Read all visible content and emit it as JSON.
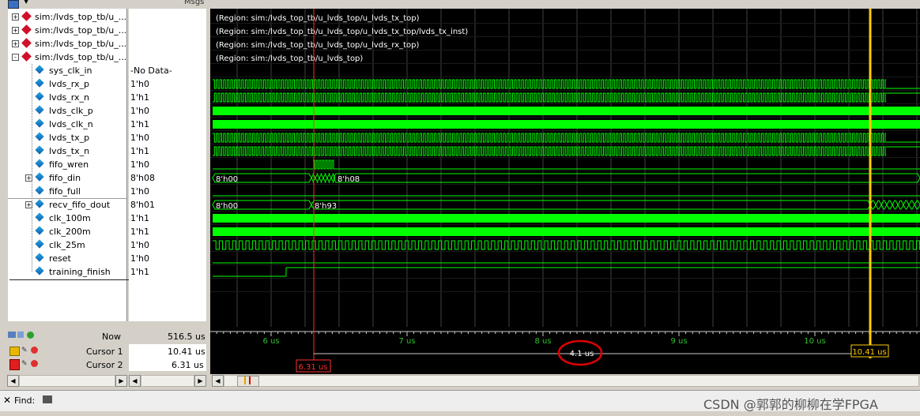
{
  "header": {
    "msgs_label": "Msgs"
  },
  "signals": [
    {
      "name": "sim:/lvds_top_tb/u_...",
      "value": "",
      "kind": "region",
      "expander": "+",
      "desc": "(Region: sim:/lvds_top_tb/u_lvds_top/u_lvds_tx_top)"
    },
    {
      "name": "sim:/lvds_top_tb/u_...",
      "value": "",
      "kind": "region",
      "expander": "+",
      "desc": "(Region: sim:/lvds_top_tb/u_lvds_top/u_lvds_tx_top/lvds_tx_inst)"
    },
    {
      "name": "sim:/lvds_top_tb/u_...",
      "value": "",
      "kind": "region",
      "expander": "+",
      "desc": "(Region: sim:/lvds_top_tb/u_lvds_top/u_lvds_rx_top)"
    },
    {
      "name": "sim:/lvds_top_tb/u_...",
      "value": "",
      "kind": "region",
      "expander": "-",
      "desc": "(Region: sim:/lvds_top_tb/u_lvds_top)"
    },
    {
      "name": "sys_clk_in",
      "value": "-No Data-",
      "kind": "signal"
    },
    {
      "name": "lvds_rx_p",
      "value": "1'h0",
      "kind": "signal"
    },
    {
      "name": "lvds_rx_n",
      "value": "1'h1",
      "kind": "signal"
    },
    {
      "name": "lvds_clk_p",
      "value": "1'h0",
      "kind": "signal"
    },
    {
      "name": "lvds_clk_n",
      "value": "1'h1",
      "kind": "signal"
    },
    {
      "name": "lvds_tx_p",
      "value": "1'h0",
      "kind": "signal"
    },
    {
      "name": "lvds_tx_n",
      "value": "1'h1",
      "kind": "signal"
    },
    {
      "name": "fifo_wren",
      "value": "1'h0",
      "kind": "signal"
    },
    {
      "name": "fifo_din",
      "value": "8'h08",
      "kind": "bus",
      "expander": "+"
    },
    {
      "name": "fifo_full",
      "value": "1'h0",
      "kind": "signal"
    },
    {
      "name": "recv_fifo_dout",
      "value": "8'h01",
      "kind": "bus",
      "expander": "+",
      "selected": true
    },
    {
      "name": "clk_100m",
      "value": "1'h1",
      "kind": "signal"
    },
    {
      "name": "clk_200m",
      "value": "1'h1",
      "kind": "signal"
    },
    {
      "name": "clk_25m",
      "value": "1'h0",
      "kind": "signal"
    },
    {
      "name": "reset",
      "value": "1'h0",
      "kind": "signal"
    },
    {
      "name": "training_finish",
      "value": "1'h1",
      "kind": "signal"
    }
  ],
  "wave_labels": {
    "fifo_din_before": "8'h00",
    "fifo_din_after": "8'h08",
    "recv_before": "8'h00",
    "recv_after": "8'h93"
  },
  "timeline": {
    "ticks": [
      "6 us",
      "7 us",
      "8 us",
      "9 us",
      "10 us"
    ],
    "now_label": "Now",
    "now_value": "516.5 us",
    "cursor1_label": "Cursor 1",
    "cursor1_value": "10.41 us",
    "cursor2_label": "Cursor 2",
    "cursor2_value": "6.31 us",
    "cursor1_tag": "10.41 us",
    "cursor2_tag": "6.31 us",
    "delta": "4.1 us"
  },
  "findbar": {
    "label": "Find:"
  },
  "watermark": "CSDN @郭郭的柳柳在学FPGA",
  "colors": {
    "wave": "#00ff00",
    "cursor1": "#ffcc00",
    "cursor2": "#ff3030",
    "grid": "#404040",
    "annotation": "#e00000"
  }
}
